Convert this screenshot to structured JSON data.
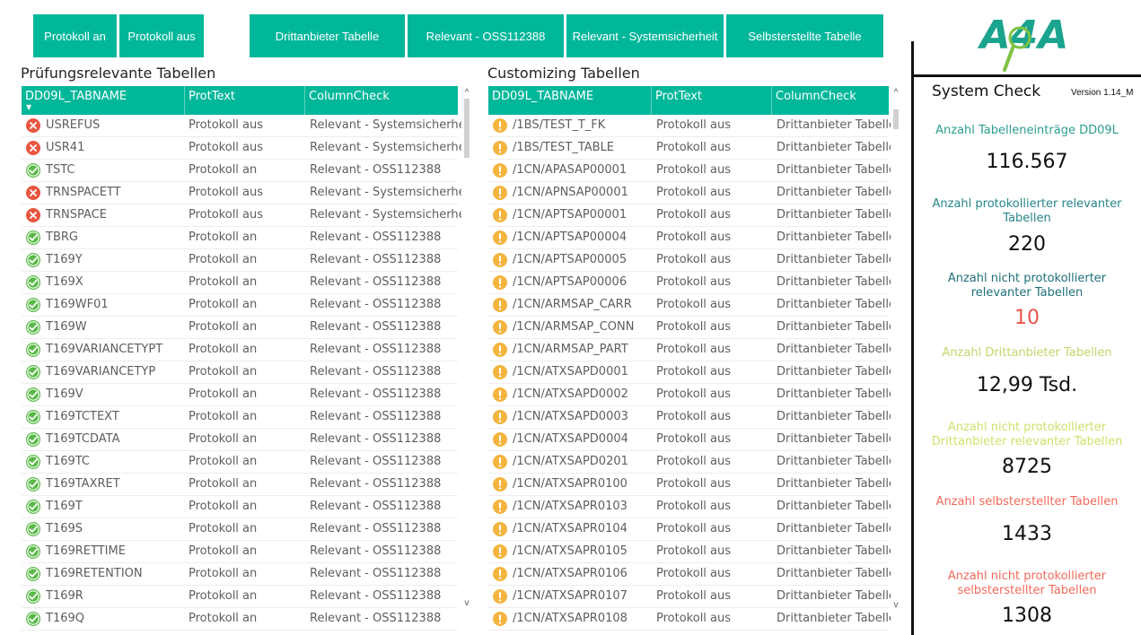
{
  "toolbar": {
    "protokoll_an": "Protokoll an",
    "protokoll_aus": "Protokoll aus",
    "drittanbieter": "Drittanbieter Tabelle",
    "relevant_oss": "Relevant - OSS112388",
    "relevant_sys": "Relevant - Systemsicherheit",
    "selbst": "Selbsterstellte Tabelle"
  },
  "left_table": {
    "title": "Prüfungsrelevante Tabellen",
    "columns": [
      "DD09L_TABNAME",
      "ProtText",
      "ColumnCheck"
    ],
    "rows": [
      {
        "status": "error",
        "name": "USREFUS",
        "prot": "Protokoll aus",
        "check": "Relevant - Systemsicherheit"
      },
      {
        "status": "error",
        "name": "USR41",
        "prot": "Protokoll aus",
        "check": "Relevant - Systemsicherheit"
      },
      {
        "status": "ok",
        "name": "TSTC",
        "prot": "Protokoll an",
        "check": "Relevant - OSS112388"
      },
      {
        "status": "error",
        "name": "TRNSPACETT",
        "prot": "Protokoll aus",
        "check": "Relevant - Systemsicherheit"
      },
      {
        "status": "error",
        "name": "TRNSPACE",
        "prot": "Protokoll aus",
        "check": "Relevant - Systemsicherheit"
      },
      {
        "status": "ok",
        "name": "TBRG",
        "prot": "Protokoll an",
        "check": "Relevant - OSS112388"
      },
      {
        "status": "ok",
        "name": "T169Y",
        "prot": "Protokoll an",
        "check": "Relevant - OSS112388"
      },
      {
        "status": "ok",
        "name": "T169X",
        "prot": "Protokoll an",
        "check": "Relevant - OSS112388"
      },
      {
        "status": "ok",
        "name": "T169WF01",
        "prot": "Protokoll an",
        "check": "Relevant - OSS112388"
      },
      {
        "status": "ok",
        "name": "T169W",
        "prot": "Protokoll an",
        "check": "Relevant - OSS112388"
      },
      {
        "status": "ok",
        "name": "T169VARIANCETYPT",
        "prot": "Protokoll an",
        "check": "Relevant - OSS112388"
      },
      {
        "status": "ok",
        "name": "T169VARIANCETYP",
        "prot": "Protokoll an",
        "check": "Relevant - OSS112388"
      },
      {
        "status": "ok",
        "name": "T169V",
        "prot": "Protokoll an",
        "check": "Relevant - OSS112388"
      },
      {
        "status": "ok",
        "name": "T169TCTEXT",
        "prot": "Protokoll an",
        "check": "Relevant - OSS112388"
      },
      {
        "status": "ok",
        "name": "T169TCDATA",
        "prot": "Protokoll an",
        "check": "Relevant - OSS112388"
      },
      {
        "status": "ok",
        "name": "T169TC",
        "prot": "Protokoll an",
        "check": "Relevant - OSS112388"
      },
      {
        "status": "ok",
        "name": "T169TAXRET",
        "prot": "Protokoll an",
        "check": "Relevant - OSS112388"
      },
      {
        "status": "ok",
        "name": "T169T",
        "prot": "Protokoll an",
        "check": "Relevant - OSS112388"
      },
      {
        "status": "ok",
        "name": "T169S",
        "prot": "Protokoll an",
        "check": "Relevant - OSS112388"
      },
      {
        "status": "ok",
        "name": "T169RETTIME",
        "prot": "Protokoll an",
        "check": "Relevant - OSS112388"
      },
      {
        "status": "ok",
        "name": "T169RETENTION",
        "prot": "Protokoll an",
        "check": "Relevant - OSS112388"
      },
      {
        "status": "ok",
        "name": "T169R",
        "prot": "Protokoll an",
        "check": "Relevant - OSS112388"
      },
      {
        "status": "ok",
        "name": "T169Q",
        "prot": "Protokoll an",
        "check": "Relevant - OSS112388"
      }
    ]
  },
  "right_table": {
    "title": "Customizing Tabellen",
    "columns": [
      "DD09L_TABNAME",
      "ProtText",
      "ColumnCheck"
    ],
    "rows": [
      {
        "status": "warn",
        "name": "/1BS/TEST_T_FK",
        "prot": "Protokoll aus",
        "check": "Drittanbieter Tabelle"
      },
      {
        "status": "warn",
        "name": "/1BS/TEST_TABLE",
        "prot": "Protokoll aus",
        "check": "Drittanbieter Tabelle"
      },
      {
        "status": "warn",
        "name": "/1CN/APASAP00001",
        "prot": "Protokoll aus",
        "check": "Drittanbieter Tabelle"
      },
      {
        "status": "warn",
        "name": "/1CN/APNSAP00001",
        "prot": "Protokoll aus",
        "check": "Drittanbieter Tabelle"
      },
      {
        "status": "warn",
        "name": "/1CN/APTSAP00001",
        "prot": "Protokoll aus",
        "check": "Drittanbieter Tabelle"
      },
      {
        "status": "warn",
        "name": "/1CN/APTSAP00004",
        "prot": "Protokoll aus",
        "check": "Drittanbieter Tabelle"
      },
      {
        "status": "warn",
        "name": "/1CN/APTSAP00005",
        "prot": "Protokoll aus",
        "check": "Drittanbieter Tabelle"
      },
      {
        "status": "warn",
        "name": "/1CN/APTSAP00006",
        "prot": "Protokoll aus",
        "check": "Drittanbieter Tabelle"
      },
      {
        "status": "warn",
        "name": "/1CN/ARMSAP_CARR",
        "prot": "Protokoll aus",
        "check": "Drittanbieter Tabelle"
      },
      {
        "status": "warn",
        "name": "/1CN/ARMSAP_CONN",
        "prot": "Protokoll aus",
        "check": "Drittanbieter Tabelle"
      },
      {
        "status": "warn",
        "name": "/1CN/ARMSAP_PART",
        "prot": "Protokoll aus",
        "check": "Drittanbieter Tabelle"
      },
      {
        "status": "warn",
        "name": "/1CN/ATXSAPD0001",
        "prot": "Protokoll aus",
        "check": "Drittanbieter Tabelle"
      },
      {
        "status": "warn",
        "name": "/1CN/ATXSAPD0002",
        "prot": "Protokoll aus",
        "check": "Drittanbieter Tabelle"
      },
      {
        "status": "warn",
        "name": "/1CN/ATXSAPD0003",
        "prot": "Protokoll aus",
        "check": "Drittanbieter Tabelle"
      },
      {
        "status": "warn",
        "name": "/1CN/ATXSAPD0004",
        "prot": "Protokoll aus",
        "check": "Drittanbieter Tabelle"
      },
      {
        "status": "warn",
        "name": "/1CN/ATXSAPD0201",
        "prot": "Protokoll aus",
        "check": "Drittanbieter Tabelle"
      },
      {
        "status": "warn",
        "name": "/1CN/ATXSAPR0100",
        "prot": "Protokoll aus",
        "check": "Drittanbieter Tabelle"
      },
      {
        "status": "warn",
        "name": "/1CN/ATXSAPR0103",
        "prot": "Protokoll aus",
        "check": "Drittanbieter Tabelle"
      },
      {
        "status": "warn",
        "name": "/1CN/ATXSAPR0104",
        "prot": "Protokoll aus",
        "check": "Drittanbieter Tabelle"
      },
      {
        "status": "warn",
        "name": "/1CN/ATXSAPR0105",
        "prot": "Protokoll aus",
        "check": "Drittanbieter Tabelle"
      },
      {
        "status": "warn",
        "name": "/1CN/ATXSAPR0106",
        "prot": "Protokoll aus",
        "check": "Drittanbieter Tabelle"
      },
      {
        "status": "warn",
        "name": "/1CN/ATXSAPR0107",
        "prot": "Protokoll aus",
        "check": "Drittanbieter Tabelle"
      },
      {
        "status": "warn",
        "name": "/1CN/ATXSAPR0108",
        "prot": "Protokoll aus",
        "check": "Drittanbieter Tabelle"
      }
    ]
  },
  "system_check": {
    "logo_text": "A4A",
    "title": "System Check",
    "version": "Version 1.14_M",
    "kpis": [
      {
        "label": "Anzahl Tabelleneinträge DD09L",
        "value": "116.567",
        "label_color": "#2a9d8f",
        "value_color": "#111111"
      },
      {
        "label": "Anzahl protokollierter relevanter Tabellen",
        "value": "220",
        "label_color": "#25858a",
        "value_color": "#111111"
      },
      {
        "label": "Anzahl nicht protokollierter relevanter Tabellen",
        "value": "10",
        "label_color": "#1f6f7a",
        "value_color": "#e8564a"
      },
      {
        "label": "Anzahl Drittanbieter Tabellen",
        "value": "12,99 Tsd.",
        "label_color": "#c3d66a",
        "value_color": "#111111"
      },
      {
        "label": "Anzahl nicht protokollierter Drittanbieter relevanter Tabellen",
        "value": "8725",
        "label_color": "#d2df6a",
        "value_color": "#111111"
      },
      {
        "label": "Anzahl selbsterstellter Tabellen",
        "value": "1433",
        "label_color": "#f06a5a",
        "value_color": "#111111"
      },
      {
        "label": "Anzahl nicht protokollierter selbsterstellter Tabellen",
        "value": "1308",
        "label_color": "#f06a5a",
        "value_color": "#111111"
      }
    ]
  },
  "colors": {
    "accent": "#01b79a",
    "ok": "#58b947",
    "error": "#e8563f",
    "warn": "#f3b53f"
  },
  "icons": {
    "ok": "check-circle-icon",
    "error": "x-circle-icon",
    "warn": "exclamation-circle-icon",
    "sort": "sort-down-icon",
    "logo": "magnifier-icon"
  }
}
